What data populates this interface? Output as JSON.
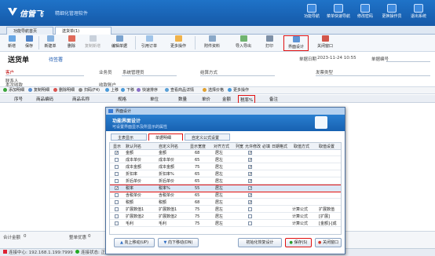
{
  "app": {
    "name": "信管飞",
    "slogan": "精细化管理软件"
  },
  "top_buttons": [
    {
      "label": "功能导航"
    },
    {
      "label": "菜单快速导航"
    },
    {
      "label": "修改密码"
    },
    {
      "label": "更换操作员"
    },
    {
      "label": "退出系统"
    }
  ],
  "tabs": [
    {
      "label": "功能导航首页"
    },
    {
      "label": "送货单(1)"
    }
  ],
  "toolbar": [
    {
      "label": "新增"
    },
    {
      "label": "保存"
    },
    {
      "label": "新建单"
    },
    {
      "label": "删除"
    },
    {
      "label": "复制新增"
    },
    {
      "label": "编辑单据"
    },
    {
      "label": "引用订单"
    },
    {
      "label": "更多操作"
    },
    {
      "label": "附件资料"
    },
    {
      "label": "导入导出"
    },
    {
      "label": "打印"
    },
    {
      "label": "界面设计"
    },
    {
      "label": "关闭窗口"
    }
  ],
  "form": {
    "title": "送货单",
    "code": "待签署",
    "date_label": "单据日期",
    "date_value": "2023-11-24 10:55",
    "no_label": "单据编号",
    "customer_label": "客户",
    "salesman_label": "业务员",
    "salesman_value": "系统管理员",
    "settle_label": "结算方式",
    "invoice_label": "发票类型",
    "contact_label": "联系人",
    "receive_label": "本次收款",
    "account_label": "收款账户"
  },
  "subbar": [
    "添加明细",
    "复制明细",
    "删除明细",
    "扫码(F4)",
    "上移",
    "下移",
    "快速排序",
    "查看商品详情",
    "选择价格",
    "更多操作"
  ],
  "grid_cols": [
    "序号",
    "商品编码",
    "商品名称",
    "规格",
    "单位",
    "数量",
    "单价",
    "金额",
    "税率%",
    "备注"
  ],
  "bottom": {
    "total_label": "合计金额",
    "total_value": "0",
    "discount_label": "整单优惠",
    "discount_value": "0"
  },
  "status": {
    "server": "连接中心: 192.168.1.199:7999",
    "conn": "连接状态: 正常"
  },
  "dialog": {
    "title": "界面设计",
    "h1": "功能界面设计",
    "h2": "可设置界面显示及所显示的属性",
    "tabs": [
      "主表显示",
      "单据明细",
      "自定义公式设置"
    ],
    "cols": [
      "显示",
      "默认列名",
      "自定义列名",
      "显示宽度",
      "对齐方式",
      "列宽",
      "允许修改",
      "必填",
      "日期格式",
      "取值方式",
      "取值设置"
    ],
    "rows": [
      {
        "show": "✓",
        "def": "金额",
        "cust": "金额",
        "w": "68",
        "align": "居左",
        "req": "✓",
        "extra": "",
        "extra2": ""
      },
      {
        "show": "",
        "def": "成本单价",
        "cust": "成本单价",
        "w": "65",
        "align": "居左",
        "req": "✓",
        "extra": "",
        "extra2": ""
      },
      {
        "show": "",
        "def": "成本金额",
        "cust": "成本金额",
        "w": "75",
        "align": "居左",
        "req": "✓",
        "extra": "",
        "extra2": ""
      },
      {
        "show": "",
        "def": "折扣率",
        "cust": "折扣率%",
        "w": "65",
        "align": "居左",
        "req": "✓",
        "extra": "",
        "extra2": ""
      },
      {
        "show": "",
        "def": "折后单价",
        "cust": "折后单价",
        "w": "65",
        "align": "居左",
        "req": "✓",
        "extra": "",
        "extra2": ""
      },
      {
        "show": "✓",
        "def": "税率",
        "cust": "税率%",
        "w": "55",
        "align": "居左",
        "req": "✓",
        "extra": "",
        "extra2": ""
      },
      {
        "show": "",
        "def": "含税单价",
        "cust": "含税单价",
        "w": "65",
        "align": "居左",
        "req": "✓",
        "extra": "",
        "extra2": ""
      },
      {
        "show": "",
        "def": "税额",
        "cust": "税额",
        "w": "68",
        "align": "居左",
        "req": "✓",
        "extra": "",
        "extra2": ""
      },
      {
        "show": "",
        "def": "扩展数值1",
        "cust": "扩展数值1",
        "w": "75",
        "align": "居左",
        "req": "",
        "extra": "计算公式",
        "extra2": "扩展数值"
      },
      {
        "show": "",
        "def": "扩展数值2",
        "cust": "扩展数值2",
        "w": "75",
        "align": "居左",
        "req": "",
        "extra": "计算公式",
        "extra2": "[扩展]"
      },
      {
        "show": "",
        "def": "毛利",
        "cust": "毛利",
        "w": "75",
        "align": "居左",
        "req": "",
        "extra": "计算公式",
        "extra2": "[金额]-[成"
      }
    ],
    "buttons": {
      "up": "向上移动(UP)",
      "down": "向下移动(DN)",
      "restore": "初始化恢复设计",
      "save": "保存(S)",
      "close": "关闭窗口"
    }
  }
}
